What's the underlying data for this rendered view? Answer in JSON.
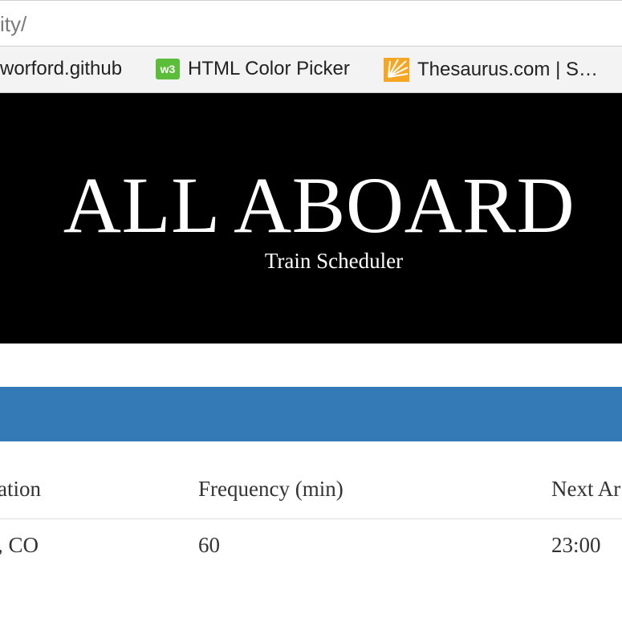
{
  "browser": {
    "url_fragment": "ity/",
    "bookmarks": [
      {
        "label": "worford.github",
        "icon": "none"
      },
      {
        "label": "HTML Color Picker",
        "icon": "color-picker-icon"
      },
      {
        "label": "Thesaurus.com | S…",
        "icon": "thesaurus-icon"
      }
    ]
  },
  "hero": {
    "title": "ALL ABOARD",
    "subtitle": "Train Scheduler"
  },
  "panel": {
    "color": "#337ab7"
  },
  "table": {
    "headers": [
      "ation",
      "Frequency (min)",
      "Next Ar"
    ],
    "rows": [
      [
        ", CO",
        "60",
        "23:00"
      ]
    ]
  }
}
